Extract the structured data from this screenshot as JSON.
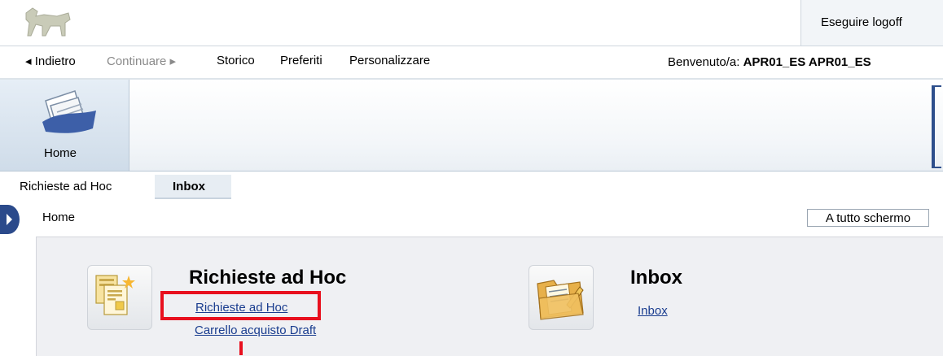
{
  "header": {
    "logoff_label": "Eseguire logoff",
    "logo_icon": "eni-dog-logo-icon"
  },
  "nav": {
    "back_label": "◂ Indietro",
    "forward_label": "Continuare ▸",
    "history_label": "Storico",
    "favorites_label": "Preferiti",
    "personalize_label": "Personalizzare",
    "welcome_prefix": "Benvenuto/a:",
    "welcome_user": "APR01_ES APR01_ES"
  },
  "main_tabs": [
    {
      "label": "Home",
      "icon": "documents-icon",
      "active": true
    }
  ],
  "sub_tabs": [
    {
      "label": "Richieste ad Hoc",
      "active": false
    },
    {
      "label": "Inbox",
      "active": true
    }
  ],
  "breadcrumb": {
    "label": "Home",
    "fullscreen_label": "A tutto schermo"
  },
  "content": {
    "sections": [
      {
        "title": "Richieste ad Hoc",
        "icon": "request-form-icon",
        "links": [
          "Richieste ad Hoc",
          "Carrello acquisto Draft"
        ]
      },
      {
        "title": "Inbox",
        "icon": "inbox-folder-icon",
        "links": [
          "Inbox"
        ]
      }
    ]
  },
  "colors": {
    "highlight": "#e8101e",
    "link": "#1a3d8f",
    "tab_active_bg": "#cfdce9"
  }
}
